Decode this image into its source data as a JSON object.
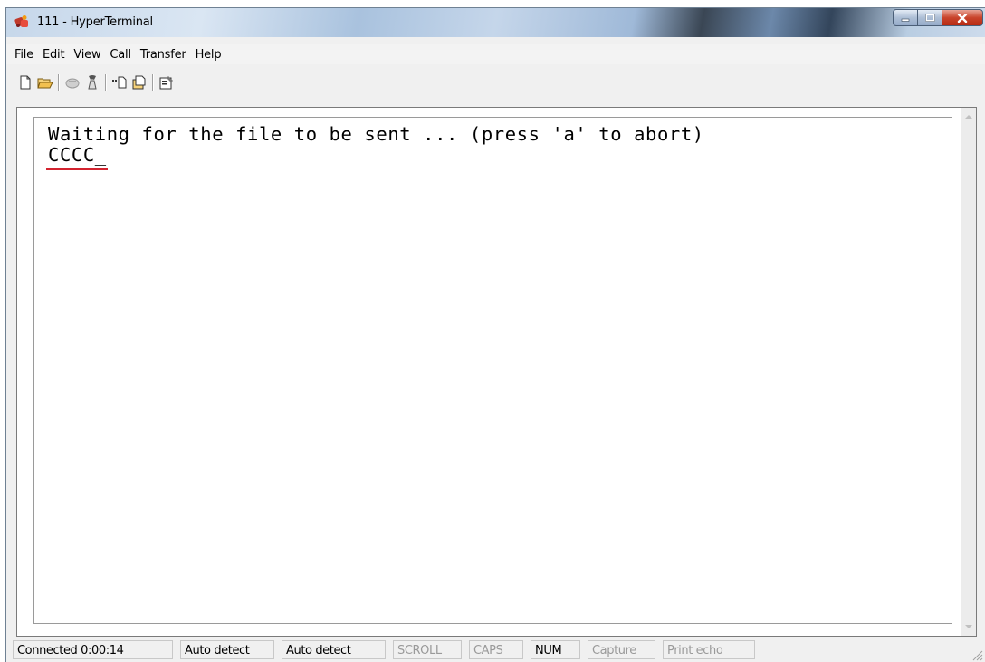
{
  "window": {
    "title": "111 - HyperTerminal",
    "app_icon": "hyperterminal-icon",
    "controls": [
      "minimize-icon",
      "maximize-icon",
      "close-icon"
    ]
  },
  "menu": {
    "items": [
      "File",
      "Edit",
      "View",
      "Call",
      "Transfer",
      "Help"
    ]
  },
  "toolbar": {
    "buttons": [
      "new-connection-icon",
      "open-icon",
      "disconnect-icon",
      "dial-icon",
      "send-file-icon",
      "receive-file-icon",
      "properties-icon"
    ]
  },
  "terminal": {
    "lines": [
      "Waiting for the file to be sent ... (press 'a' to abort)",
      "CCCC_"
    ],
    "underline_color": "#d3232f"
  },
  "statusbar": {
    "connected": "Connected 0:00:14",
    "detect1": "Auto detect",
    "detect2": "Auto detect",
    "scroll": "SCROLL",
    "caps": "CAPS",
    "num": "NUM",
    "capture": "Capture",
    "print_echo": "Print echo"
  }
}
